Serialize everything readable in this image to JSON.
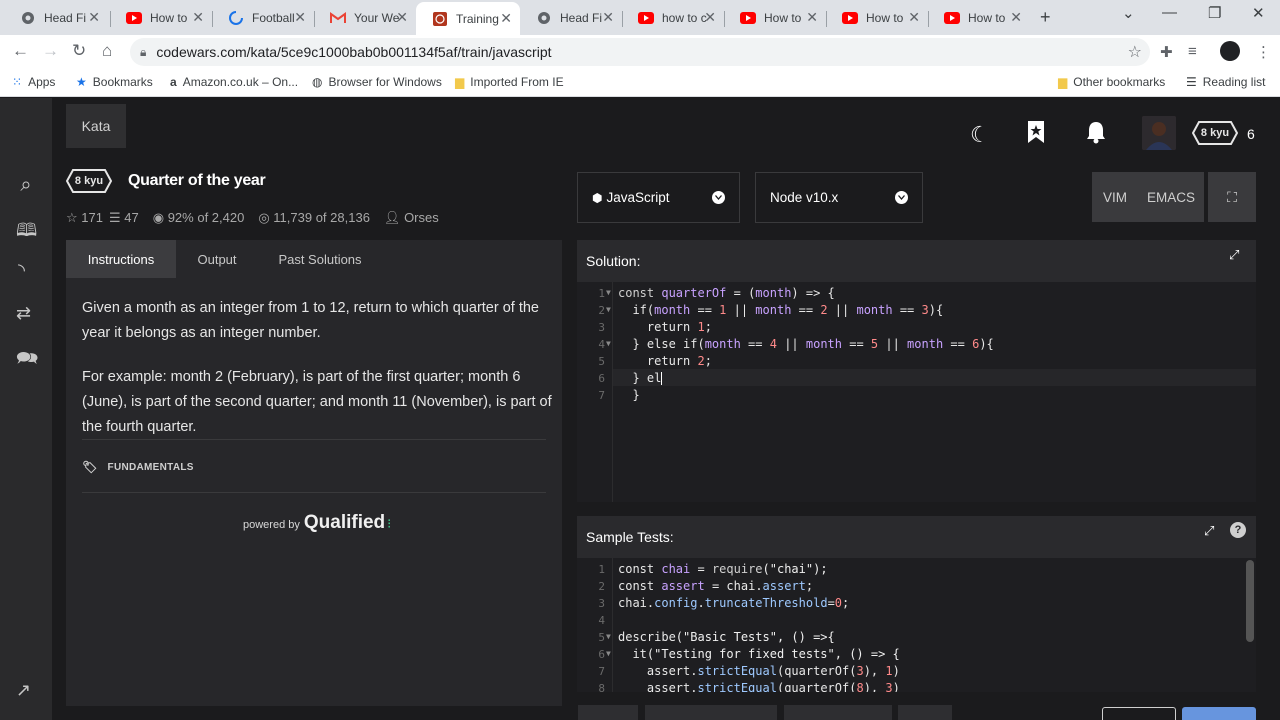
{
  "browser": {
    "tabs": [
      {
        "label": "Head Fi",
        "icon": "chrome-icon"
      },
      {
        "label": "How to",
        "icon": "youtube-icon"
      },
      {
        "label": "Football",
        "icon": "loading-icon"
      },
      {
        "label": "Your We",
        "icon": "gmail-icon"
      },
      {
        "label": "Training",
        "icon": "codewars-icon",
        "active": true
      },
      {
        "label": "Head Fi",
        "icon": "chrome-icon"
      },
      {
        "label": "how to c",
        "icon": "youtube-icon"
      },
      {
        "label": "How to",
        "icon": "youtube-icon"
      },
      {
        "label": "How to",
        "icon": "youtube-icon"
      },
      {
        "label": "How to",
        "icon": "youtube-icon"
      }
    ],
    "url": "codewars.com/kata/5ce9c1000bab0b001134f5af/train/javascript",
    "bookmarks": {
      "apps": "Apps",
      "bookmarks": "Bookmarks",
      "amazon": "Amazon.co.uk – On...",
      "browser_windows": "Browser for Windows",
      "imported": "Imported From IE",
      "other": "Other bookmarks",
      "reading": "Reading list"
    }
  },
  "nav": {
    "kata_tab": "Kata",
    "honor": "6",
    "rank_badge": "8 kyu"
  },
  "kata": {
    "rank": "8 kyu",
    "title": "Quarter of the year",
    "stars": "171",
    "collections": "47",
    "satisfaction": "92% of 2,420",
    "completed": "11,739 of 28,136",
    "author": "Orses"
  },
  "desc_tabs": {
    "instructions": "Instructions",
    "output": "Output",
    "past": "Past Solutions"
  },
  "description": {
    "p1": "Given a month as an integer from 1 to 12, return to which quarter of the year it belongs as an integer number.",
    "p2": "For example: month 2 (February), is part of the first quarter; month 6 (June), is part of the second quarter; and month 11 (November), is part of the fourth quarter.",
    "tag": "FUNDAMENTALS",
    "powered_by": "powered by",
    "qualified": "Qualified"
  },
  "editor_controls": {
    "language": "JavaScript",
    "runtime": "Node v10.x",
    "vim": "VIM",
    "emacs": "EMACS"
  },
  "solution": {
    "label": "Solution:",
    "lines": [
      "1",
      "2",
      "3",
      "4",
      "5",
      "6",
      "7"
    ]
  },
  "sample_tests": {
    "label": "Sample Tests:",
    "lines": [
      "1",
      "2",
      "3",
      "4",
      "5",
      "6",
      "7",
      "8"
    ]
  },
  "code": {
    "s1a": "const ",
    "s1b": "quarterOf",
    "s1c": " = (",
    "s1d": "month",
    "s1e": ") => {",
    "s2a": "  if(",
    "s2b": "month",
    "s2c": " == ",
    "s2d": "1",
    "s2e": " || ",
    "s2f": "month",
    "s2g": " == ",
    "s2h": "2",
    "s2i": " || ",
    "s2j": "month",
    "s2k": " == ",
    "s2l": "3",
    "s2m": "){",
    "s3a": "    return ",
    "s3b": "1",
    "s3c": ";",
    "s4a": "  } else if(",
    "s4b": "month",
    "s4c": " == ",
    "s4d": "4",
    "s4e": " || ",
    "s4f": "month",
    "s4g": " == ",
    "s4h": "5",
    "s4i": " || ",
    "s4j": "month",
    "s4k": " == ",
    "s4l": "6",
    "s4m": "){",
    "s5a": "    return ",
    "s5b": "2",
    "s5c": ";",
    "s6": "  } el",
    "s7": "  }",
    "t1a": "const ",
    "t1b": "chai",
    "t1c": " = ",
    "t1d": "require",
    "t1e": "(\"chai\");",
    "t2a": "const ",
    "t2b": "assert",
    "t2c": " = ",
    "t2d": "chai",
    "t2e": ".",
    "t2f": "assert",
    "t2g": ";",
    "t3a": "chai",
    "t3b": ".",
    "t3c": "config",
    "t3d": ".",
    "t3e": "truncateThreshold",
    "t3f": "=",
    "t3g": "0",
    "t3h": ";",
    "t4": "",
    "t5a": "describe",
    "t5b": "(\"Basic Tests\", () =>{",
    "t6a": "  it",
    "t6b": "(\"Testing for fixed tests\", () => {",
    "t7a": "    assert",
    "t7b": ".",
    "t7c": "strictEqual",
    "t7d": "(",
    "t7e": "quarterOf",
    "t7f": "(",
    "t7g": "3",
    "t7h": "), ",
    "t7i": "1",
    "t7j": ")",
    "t8a": "    assert",
    "t8b": ".",
    "t8c": "strictEqual",
    "t8d": "(",
    "t8e": "quarterOf",
    "t8f": "(",
    "t8g": "8",
    "t8h": "), ",
    "t8i": "3",
    "t8j": ")"
  }
}
